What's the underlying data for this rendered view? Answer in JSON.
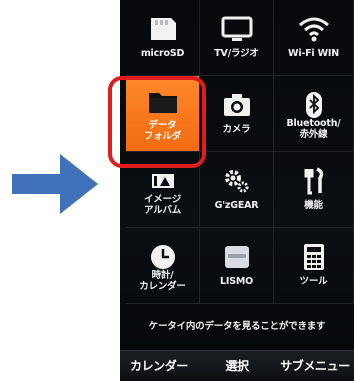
{
  "menu": {
    "tiles": [
      {
        "label": "microSD",
        "icon": "sd-card-icon"
      },
      {
        "label": "TV/ラジオ",
        "icon": "tv-icon"
      },
      {
        "label": "Wi-Fi WIN",
        "icon": "wifi-icon"
      },
      {
        "label": "データ\nフォルダ",
        "icon": "folder-icon",
        "selected": true
      },
      {
        "label": "カメラ",
        "icon": "camera-icon"
      },
      {
        "label": "Bluetooth/\n赤外線",
        "icon": "bluetooth-icon"
      },
      {
        "label": "イメージ\nアルバム",
        "icon": "image-album-icon"
      },
      {
        "label": "G'zGEAR",
        "icon": "gears-icon"
      },
      {
        "label": "機能",
        "icon": "tools-icon"
      },
      {
        "label": "時計/\nカレンダー",
        "icon": "clock-icon"
      },
      {
        "label": "LISMO",
        "icon": "lismo-icon"
      },
      {
        "label": "ツール",
        "icon": "calculator-icon"
      }
    ]
  },
  "hint": "ケータイ内のデータを見ることができます",
  "softkeys": {
    "left": "カレンダー",
    "center": "選択",
    "right": "サブメニュー"
  },
  "colors": {
    "arrow": "#3f72b8",
    "selected_tile": "#f36b10",
    "highlight_frame": "#e01d1d",
    "screen_bg": "#0b0e12"
  }
}
